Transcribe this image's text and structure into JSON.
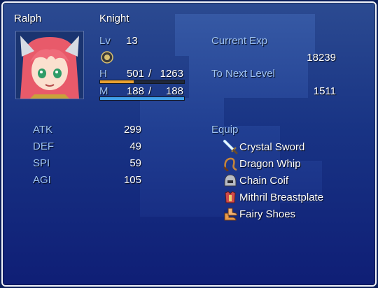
{
  "actor": {
    "name": "Ralph",
    "class": "Knight",
    "level_label": "Lv",
    "level": "13",
    "hp_label": "H",
    "hp": "501",
    "hp_max": "1263",
    "hp_ratio": 0.397,
    "mp_label": "M",
    "mp": "188",
    "mp_max": "188",
    "mp_ratio": 1.0,
    "separator": "/"
  },
  "exp": {
    "current_label": "Current Exp",
    "current": "18239",
    "next_label": "To Next Level",
    "next": "1511"
  },
  "stats": [
    {
      "label": "ATK",
      "value": "299"
    },
    {
      "label": "DEF",
      "value": "49"
    },
    {
      "label": "SPI",
      "value": "59"
    },
    {
      "label": "AGI",
      "value": "105"
    }
  ],
  "equip": {
    "header": "Equip",
    "items": [
      {
        "name": "Crystal Sword",
        "icon": "sword-icon"
      },
      {
        "name": "Dragon Whip",
        "icon": "whip-icon"
      },
      {
        "name": "Chain Coif",
        "icon": "helmet-icon"
      },
      {
        "name": "Mithril Breastplate",
        "icon": "armor-icon"
      },
      {
        "name": "Fairy Shoes",
        "icon": "shoes-icon"
      }
    ]
  },
  "colors": {
    "hp_gauge": "#e8a030",
    "mp_gauge": "#40a0e8",
    "system_text": "#9fc4f4"
  }
}
